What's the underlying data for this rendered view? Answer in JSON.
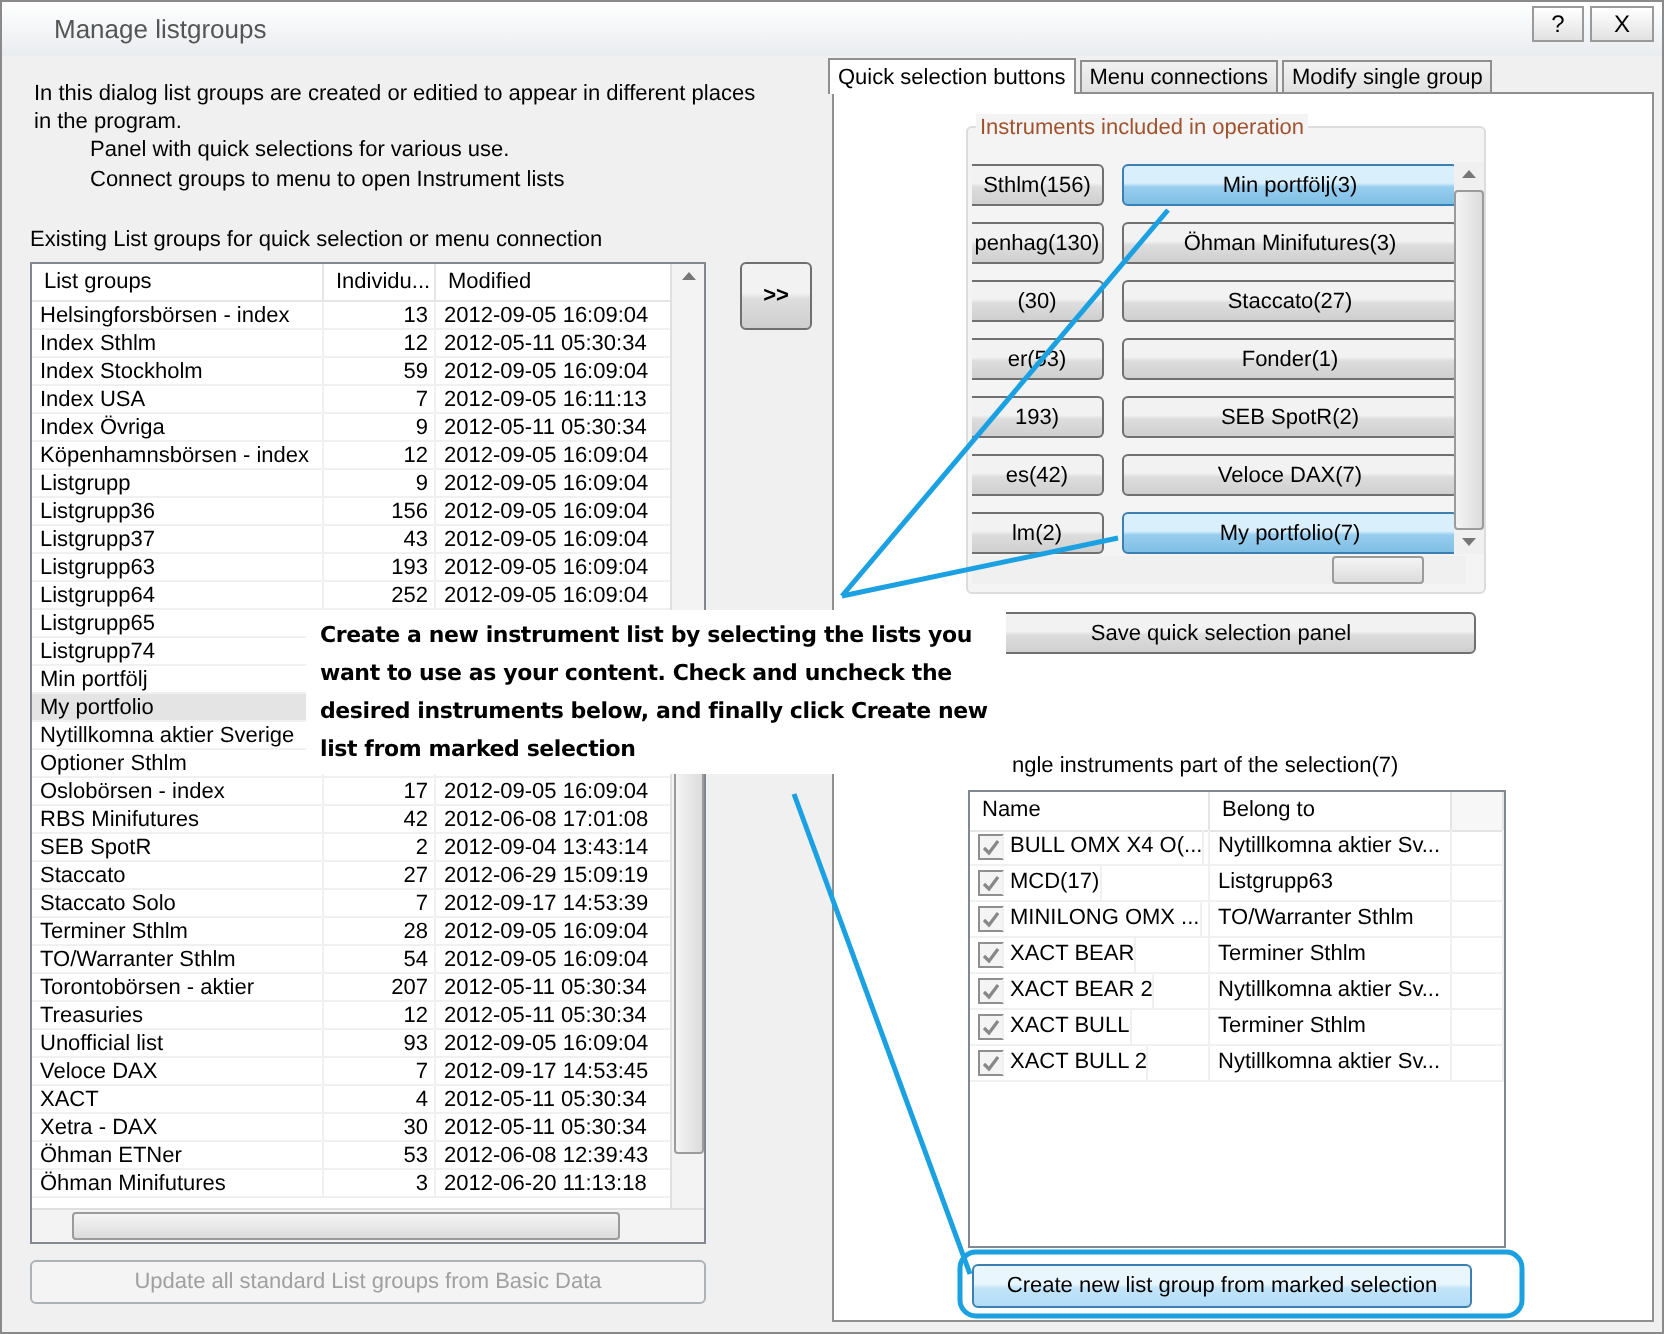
{
  "window": {
    "title": "Manage listgroups",
    "title_buttons": [
      {
        "kind": "help",
        "label": "?"
      },
      {
        "kind": "close",
        "label": "X"
      }
    ]
  },
  "intro": {
    "text": "In this dialog list groups are created or editied to appear in different places in the program.",
    "points": [
      "Panel with quick selections for various use.",
      "Connect groups to menu to open Instrument lists"
    ]
  },
  "groups": {
    "label": "Existing List groups for quick selection or menu connection",
    "columns": [
      "List groups",
      "Individu...",
      "Modified"
    ],
    "rows": [
      {
        "name": "Helsingforsbörsen - index",
        "count": "13",
        "modified": "2012-09-05 16:09:04",
        "selected": false
      },
      {
        "name": "Index Sthlm",
        "count": "12",
        "modified": "2012-05-11 05:30:34",
        "selected": false
      },
      {
        "name": "Index Stockholm",
        "count": "59",
        "modified": "2012-09-05 16:09:04",
        "selected": false
      },
      {
        "name": "Index USA",
        "count": "7",
        "modified": "2012-09-05 16:11:13",
        "selected": false
      },
      {
        "name": "Index Övriga",
        "count": "9",
        "modified": "2012-05-11 05:30:34",
        "selected": false
      },
      {
        "name": "Köpenhamnsbörsen - index",
        "count": "12",
        "modified": "2012-09-05 16:09:04",
        "selected": false
      },
      {
        "name": "Listgrupp",
        "count": "9",
        "modified": "2012-09-05 16:09:04",
        "selected": false
      },
      {
        "name": "Listgrupp36",
        "count": "156",
        "modified": "2012-09-05 16:09:04",
        "selected": false
      },
      {
        "name": "Listgrupp37",
        "count": "43",
        "modified": "2012-09-05 16:09:04",
        "selected": false
      },
      {
        "name": "Listgrupp63",
        "count": "193",
        "modified": "2012-09-05 16:09:04",
        "selected": false
      },
      {
        "name": "Listgrupp64",
        "count": "252",
        "modified": "2012-09-05 16:09:04",
        "selected": false
      },
      {
        "name": "Listgrupp65",
        "selected": false
      },
      {
        "name": "Listgrupp74",
        "selected": false
      },
      {
        "name": "Min portfölj",
        "selected": false
      },
      {
        "name": "My portfolio",
        "selected": true
      },
      {
        "name": "Nytillkomna aktier Sverige",
        "selected": false
      },
      {
        "name": "Optioner Sthlm",
        "selected": false
      },
      {
        "name": "Oslobörsen - index",
        "count": "17",
        "modified": "2012-09-05 16:09:04",
        "selected": false
      },
      {
        "name": "RBS Minifutures",
        "count": "42",
        "modified": "2012-06-08 17:01:08",
        "selected": false
      },
      {
        "name": "SEB SpotR",
        "count": "2",
        "modified": "2012-09-04 13:43:14",
        "selected": false
      },
      {
        "name": "Staccato",
        "count": "27",
        "modified": "2012-06-29 15:09:19",
        "selected": false
      },
      {
        "name": "Staccato Solo",
        "count": "7",
        "modified": "2012-09-17 14:53:39",
        "selected": false
      },
      {
        "name": "Terminer Sthlm",
        "count": "28",
        "modified": "2012-09-05 16:09:04",
        "selected": false
      },
      {
        "name": "TO/Warranter Sthlm",
        "count": "54",
        "modified": "2012-09-05 16:09:04",
        "selected": false
      },
      {
        "name": "Torontobörsen - aktier",
        "count": "207",
        "modified": "2012-05-11 05:30:34",
        "selected": false
      },
      {
        "name": "Treasuries",
        "count": "12",
        "modified": "2012-05-11 05:30:34",
        "selected": false
      },
      {
        "name": "Unofficial list",
        "count": "93",
        "modified": "2012-09-05 16:09:04",
        "selected": false
      },
      {
        "name": "Veloce DAX",
        "count": "7",
        "modified": "2012-09-17 14:53:45",
        "selected": false
      },
      {
        "name": "XACT",
        "count": "4",
        "modified": "2012-05-11 05:30:34",
        "selected": false
      },
      {
        "name": "Xetra - DAX",
        "count": "30",
        "modified": "2012-05-11 05:30:34",
        "selected": false
      },
      {
        "name": "Öhman ETNer",
        "count": "53",
        "modified": "2012-06-08 12:39:43",
        "selected": false
      },
      {
        "name": "Öhman Minifutures",
        "count": "3",
        "modified": "2012-06-20 11:13:18",
        "selected": false
      }
    ],
    "update_button": {
      "label": "Update all standard List groups from Basic Data",
      "disabled": true
    }
  },
  "move_button": ">>",
  "tabs": [
    {
      "label": "Quick selection buttons",
      "selected": true
    },
    {
      "label": "Menu connections",
      "selected": false
    },
    {
      "label": "Modify single group",
      "selected": false
    }
  ],
  "quick_panel": {
    "title": "Instruments included in operation",
    "buttons": [
      {
        "label": "Sthlm(156)",
        "selected": false
      },
      {
        "label": "Min portfölj(3)",
        "selected": true
      },
      {
        "label": "penhag(130)",
        "selected": false
      },
      {
        "label": "Öhman Minifutures(3)",
        "selected": false
      },
      {
        "label": "(30)",
        "selected": false
      },
      {
        "label": "Staccato(27)",
        "selected": false
      },
      {
        "label": "er(53)",
        "selected": false
      },
      {
        "label": "Fonder(1)",
        "selected": false
      },
      {
        "label": "193)",
        "selected": false
      },
      {
        "label": "SEB SpotR(2)",
        "selected": false
      },
      {
        "label": "es(42)",
        "selected": false
      },
      {
        "label": "Veloce DAX(7)",
        "selected": false
      },
      {
        "label": "lm(2)",
        "selected": false
      },
      {
        "label": "My portfolio(7)",
        "selected": true
      }
    ],
    "save_button": "Save quick selection panel",
    "instruments_label": "ngle instruments part of the selection(7)",
    "instrument_columns": [
      "Name",
      "Belong to"
    ],
    "instruments": [
      {
        "name": "BULL OMX X4 O(...",
        "belong": "Nytillkomna aktier Sv...",
        "checked": true
      },
      {
        "name": "MCD(17)",
        "belong": "Listgrupp63",
        "checked": true
      },
      {
        "name": "MINILONG OMX ...",
        "belong": "TO/Warranter Sthlm",
        "checked": true
      },
      {
        "name": "XACT BEAR",
        "belong": "Terminer Sthlm",
        "checked": true
      },
      {
        "name": "XACT BEAR 2",
        "belong": "Nytillkomna aktier Sv...",
        "checked": true
      },
      {
        "name": "XACT BULL",
        "belong": "Terminer Sthlm",
        "checked": true
      },
      {
        "name": "XACT BULL 2",
        "belong": "Nytillkomna aktier Sv...",
        "checked": true
      }
    ],
    "create_button": "Create new list group from marked selection"
  },
  "callout": {
    "text": "Create a new instrument list by selecting the lists you want to use as your content. Check and uncheck the desired instruments below, and finally click Create new list from marked selection"
  }
}
